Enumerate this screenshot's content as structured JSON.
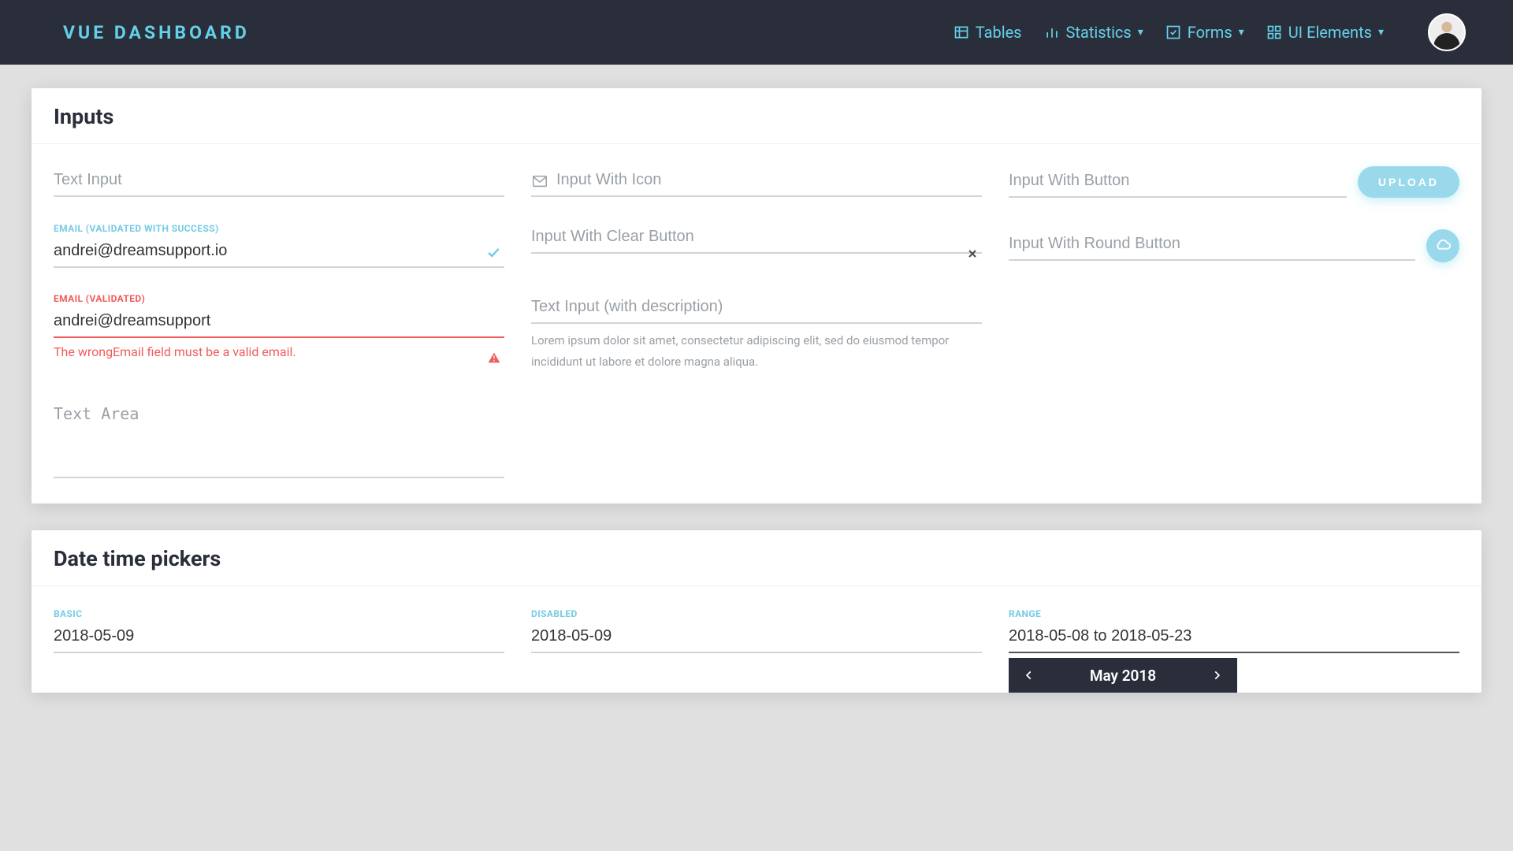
{
  "header": {
    "brand": "VUE DASHBOARD",
    "nav": {
      "tables": "Tables",
      "statistics": "Statistics",
      "forms": "Forms",
      "ui": "UI Elements"
    }
  },
  "sections": {
    "inputs": {
      "title": "Inputs",
      "textInput": {
        "placeholder": "Text Input"
      },
      "iconInput": {
        "placeholder": "Input With Icon"
      },
      "buttonInput": {
        "placeholder": "Input With Button",
        "btn": "UPLOAD"
      },
      "emailSuccess": {
        "label": "EMAIL (VALIDATED WITH SUCCESS)",
        "value": "andrei@dreamsupport.io"
      },
      "clearInput": {
        "placeholder": "Input With Clear Button"
      },
      "roundInput": {
        "placeholder": "Input With Round Button"
      },
      "emailError": {
        "label": "EMAIL (VALIDATED)",
        "value": "andrei@dreamsupport",
        "msg": "The wrongEmail field must be a valid email."
      },
      "descInput": {
        "placeholder": "Text Input (with description)",
        "desc": "Lorem ipsum dolor sit amet, consectetur adipiscing elit, sed do eiusmod tempor incididunt ut labore et dolore magna aliqua."
      },
      "textarea": {
        "placeholder": "Text Area"
      }
    },
    "datetime": {
      "title": "Date time pickers",
      "basic": {
        "label": "BASIC",
        "value": "2018-05-09"
      },
      "disabled": {
        "label": "DISABLED",
        "value": "2018-05-09"
      },
      "range": {
        "label": "RANGE",
        "value": "2018-05-08 to 2018-05-23",
        "calendar_title": "May 2018"
      }
    }
  }
}
